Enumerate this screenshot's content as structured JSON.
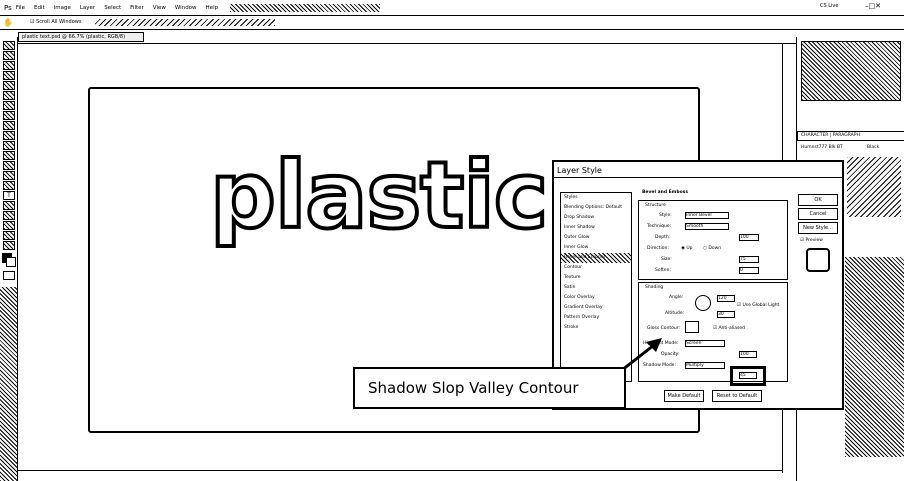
{
  "app": {
    "menu": [
      "File",
      "Edit",
      "Image",
      "Layer",
      "Select",
      "Filter",
      "View",
      "Window",
      "Help"
    ],
    "options_scroll_all": "Scroll All Windows",
    "workspace": "CS Live",
    "document_tab": "plastic text.psd @ 66.7% (plastic, RGB/8)"
  },
  "canvas": {
    "text": "plastic"
  },
  "dialog": {
    "title": "Layer Style",
    "styles": [
      "Styles",
      "Blending Options: Default",
      "Drop Shadow",
      "Inner Shadow",
      "Outer Glow",
      "Inner Glow",
      "Bevel and Emboss",
      "Contour",
      "Texture",
      "Satin",
      "Color Overlay",
      "Gradient Overlay",
      "Pattern Overlay",
      "Stroke"
    ],
    "section_title": "Bevel and Emboss",
    "structure_label": "Structure",
    "shading_label": "Shading",
    "style_label": "Style:",
    "style_value": "Inner Bevel",
    "technique_label": "Technique:",
    "technique_value": "Smooth",
    "depth_label": "Depth:",
    "depth_value": "100",
    "direction_label": "Direction:",
    "dir_up": "Up",
    "dir_down": "Down",
    "size_label": "Size:",
    "size_value": "75",
    "soften_label": "Soften:",
    "soften_value": "0",
    "angle_label": "Angle:",
    "angle_value": "120",
    "global_light": "Use Global Light",
    "altitude_label": "Altitude:",
    "altitude_value": "30",
    "gloss_contour_label": "Gloss Contour:",
    "anti_aliased": "Anti-aliased",
    "highlight_mode_label": "Highlight Mode:",
    "highlight_mode_value": "Screen",
    "opacity_label": "Opacity:",
    "opacity_value": "100",
    "shadow_mode_label": "Shadow Mode:",
    "shadow_mode_value": "Multiply",
    "shadow_opacity_value": "45",
    "make_default": "Make Default",
    "reset_default": "Reset to Default",
    "ok": "OK",
    "cancel": "Cancel",
    "new_style": "New Style...",
    "preview": "Preview"
  },
  "callout": {
    "text": "Shadow Slop Valley Contour"
  },
  "panels": {
    "tabs": "CHARACTER | PARAGRAPH",
    "font": "Humnst777 Blk BT",
    "font_style": "Black"
  }
}
